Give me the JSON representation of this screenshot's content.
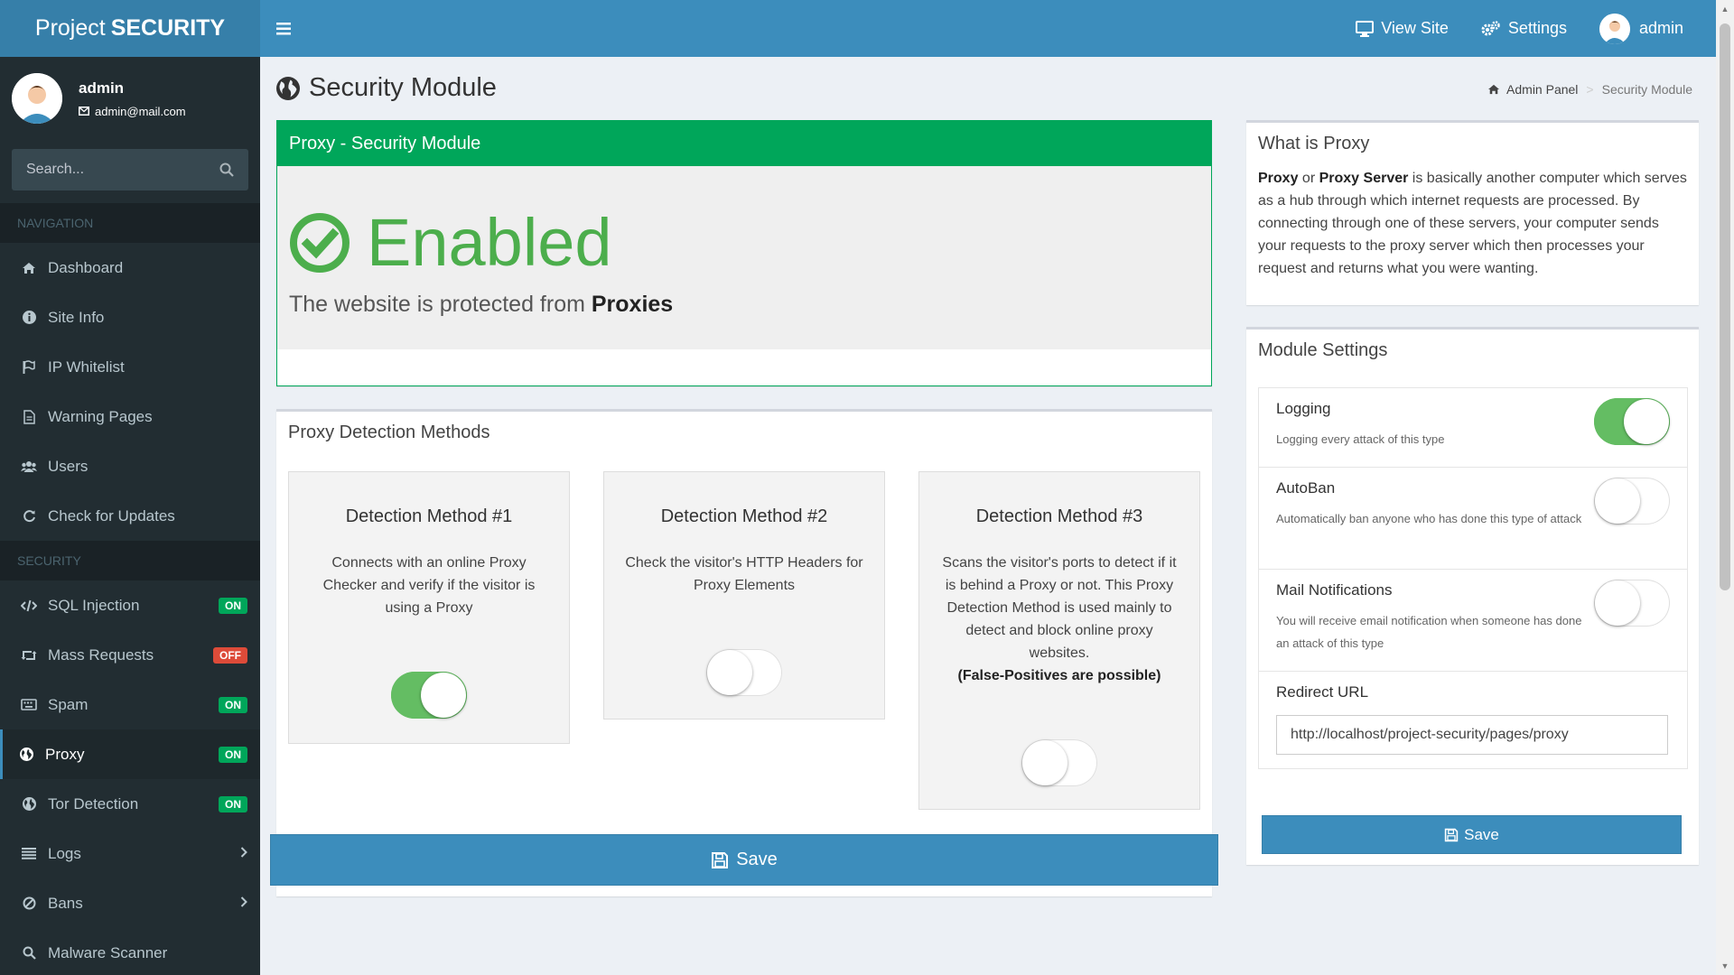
{
  "app": {
    "logo_light": "Project",
    "logo_bold": "SECURITY"
  },
  "topbar": {
    "view_site": "View Site",
    "settings": "Settings",
    "user": "admin"
  },
  "user_panel": {
    "name": "admin",
    "email": "admin@mail.com"
  },
  "search": {
    "placeholder": "Search..."
  },
  "sidebar": {
    "navigation_header": "NAVIGATION",
    "security_header": "SECURITY",
    "nav_items": [
      {
        "label": "Dashboard",
        "icon": "home-icon"
      },
      {
        "label": "Site Info",
        "icon": "info-icon"
      },
      {
        "label": "IP Whitelist",
        "icon": "flag-icon"
      },
      {
        "label": "Warning Pages",
        "icon": "file-icon"
      },
      {
        "label": "Users",
        "icon": "users-icon"
      },
      {
        "label": "Check for Updates",
        "icon": "refresh-icon"
      }
    ],
    "security_items": [
      {
        "label": "SQL Injection",
        "icon": "code-icon",
        "badge": "ON",
        "badge_color": "#00a65a"
      },
      {
        "label": "Mass Requests",
        "icon": "retweet-icon",
        "badge": "OFF",
        "badge_color": "#dd4b39"
      },
      {
        "label": "Spam",
        "icon": "keyboard-icon",
        "badge": "ON",
        "badge_color": "#00a65a"
      },
      {
        "label": "Proxy",
        "icon": "globe-icon",
        "badge": "ON",
        "badge_color": "#00a65a"
      },
      {
        "label": "Tor Detection",
        "icon": "globe-icon",
        "badge": "ON",
        "badge_color": "#00a65a"
      },
      {
        "label": "Logs",
        "icon": "list-icon"
      },
      {
        "label": "Bans",
        "icon": "ban-icon"
      },
      {
        "label": "Malware Scanner",
        "icon": "search-icon"
      }
    ]
  },
  "page": {
    "title": "Security Module",
    "breadcrumb_home": "Admin Panel",
    "breadcrumb_current": "Security Module"
  },
  "status": {
    "header": "Proxy - Security Module",
    "state": "Enabled",
    "message_prefix": "The website is protected from",
    "message_bold": "Proxies"
  },
  "detection": {
    "title": "Proxy Detection Methods",
    "methods": [
      {
        "title": "Detection Method #1",
        "desc": "Connects with an online Proxy Checker and verify if the visitor is using a Proxy",
        "note": "",
        "enabled": true
      },
      {
        "title": "Detection Method #2",
        "desc": "Check the visitor's HTTP Headers for Proxy Elements",
        "note": "",
        "enabled": false
      },
      {
        "title": "Detection Method #3",
        "desc": "Scans the visitor's ports to detect if it is behind a Proxy or not. This Proxy Detection Method is used mainly to detect and block online proxy websites.",
        "note": "(False-Positives are possible)",
        "enabled": false
      }
    ],
    "save_label": "Save"
  },
  "what_is": {
    "title": "What is Proxy",
    "bold1": "Proxy",
    "or": "or",
    "bold2": "Proxy Server",
    "text": "is basically another computer which serves as a hub through which internet requests are processed. By connecting through one of these servers, your computer sends your requests to the proxy server which then processes your request and returns what you were wanting."
  },
  "module_settings": {
    "title": "Module Settings",
    "logging_label": "Logging",
    "logging_desc": "Logging every attack of this type",
    "logging_on": true,
    "autoban_label": "AutoBan",
    "autoban_desc": "Automatically ban anyone who has done this type of attack",
    "autoban_on": false,
    "mail_label": "Mail Notifications",
    "mail_desc": "You will receive email notification when someone has done an attack of this type",
    "mail_on": false,
    "redirect_label": "Redirect URL",
    "redirect_value": "http://localhost/project-security/pages/proxy",
    "save_label": "Save"
  },
  "colors": {
    "primary": "#3c8dbc",
    "success": "#00a65a",
    "danger": "#dd4b39",
    "sidebar": "#222d32",
    "toggle_on": "#64bd63"
  }
}
